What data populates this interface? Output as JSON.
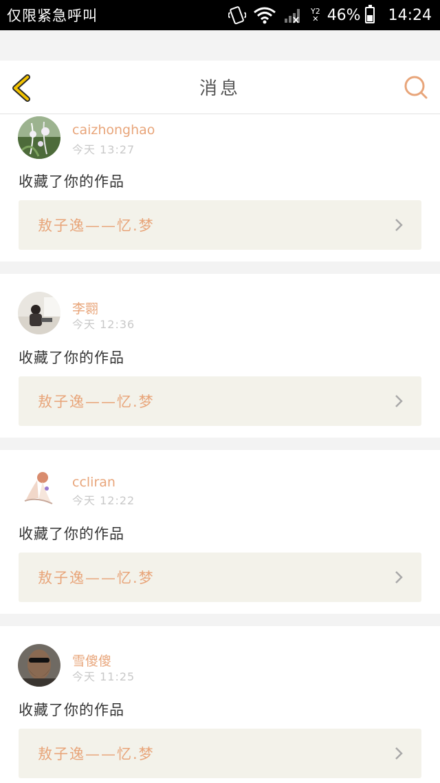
{
  "status_bar": {
    "carrier_text": "仅限紧急呼叫",
    "battery": "46%",
    "time": "14:24",
    "sim_label": "Y2",
    "battery_level": 0.46
  },
  "header": {
    "title": "消息"
  },
  "messages": [
    {
      "username": "caizhonghao",
      "time": "今天 13:27",
      "action": "收藏了你的作品",
      "work_title": "敖子逸——忆.梦"
    },
    {
      "username": "李翾",
      "time": "今天 12:36",
      "action": "收藏了你的作品",
      "work_title": "敖子逸——忆.梦"
    },
    {
      "username": "ccliran",
      "time": "今天 12:22",
      "action": "收藏了你的作品",
      "work_title": "敖子逸——忆.梦"
    },
    {
      "username": "雪傻傻",
      "time": "今天 11:25",
      "action": "收藏了你的作品",
      "work_title": "敖子逸——忆.梦"
    }
  ],
  "colors": {
    "accent": "#e8a57a",
    "back_arrow": "#f2c200",
    "work_bg": "#f3f2ea"
  }
}
